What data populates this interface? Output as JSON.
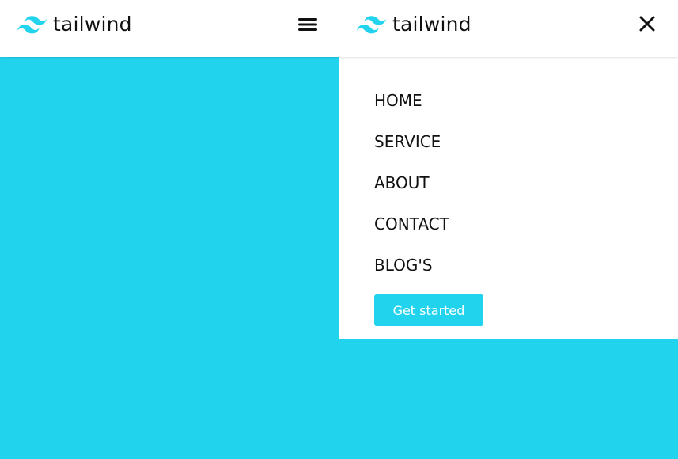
{
  "colors": {
    "accent": "#22d3ee",
    "surface": "#ffffff",
    "text": "#111111"
  },
  "left_pane": {
    "header": {
      "brand_name": "tailwind",
      "logo_icon": "tailwind-logo-icon",
      "menu_icon": "hamburger-menu-icon"
    }
  },
  "right_pane": {
    "header": {
      "brand_name": "tailwind",
      "logo_icon": "tailwind-logo-icon",
      "close_icon": "close-icon"
    },
    "nav": {
      "items": [
        {
          "label": "HOME"
        },
        {
          "label": "SERVICE"
        },
        {
          "label": "ABOUT"
        },
        {
          "label": "CONTACT"
        },
        {
          "label": "BLOG'S"
        }
      ],
      "cta_label": "Get started"
    }
  }
}
